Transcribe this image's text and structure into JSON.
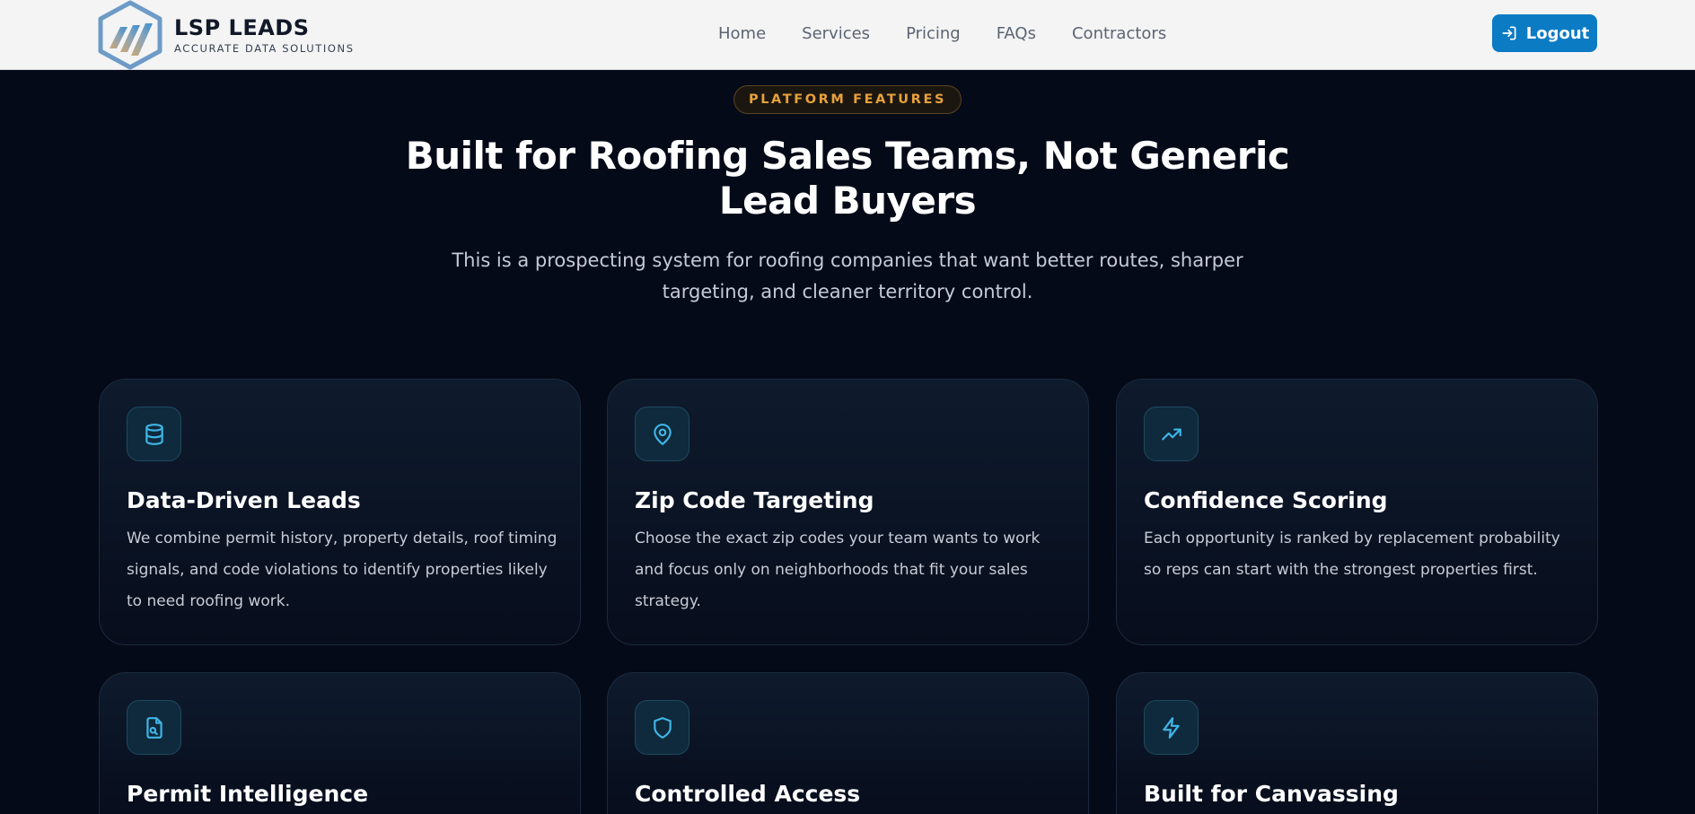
{
  "brand": {
    "name": "LSP LEADS",
    "tagline": "ACCURATE DATA SOLUTIONS"
  },
  "nav": {
    "items": [
      {
        "label": "Home"
      },
      {
        "label": "Services"
      },
      {
        "label": "Pricing"
      },
      {
        "label": "FAQs"
      },
      {
        "label": "Contractors"
      }
    ],
    "logout_label": "Logout"
  },
  "hero": {
    "badge": "PLATFORM FEATURES",
    "title": "Built for Roofing Sales Teams, Not Generic Lead Buyers",
    "subtitle": "This is a prospecting system for roofing companies that want better routes, sharper targeting, and cleaner territory control."
  },
  "features": [
    {
      "icon": "database-icon",
      "title": "Data-Driven Leads",
      "description": "We combine permit history, property details, roof timing signals, and code violations to identify properties likely to need roofing work."
    },
    {
      "icon": "map-pin-icon",
      "title": "Zip Code Targeting",
      "description": "Choose the exact zip codes your team wants to work and focus only on neighborhoods that fit your sales strategy."
    },
    {
      "icon": "trending-up-icon",
      "title": "Confidence Scoring",
      "description": "Each opportunity is ranked by replacement probability so reps can start with the strongest properties first."
    },
    {
      "icon": "file-search-icon",
      "title": "Permit Intelligence",
      "description": ""
    },
    {
      "icon": "shield-icon",
      "title": "Controlled Access",
      "description": ""
    },
    {
      "icon": "lightning-icon",
      "title": "Built for Canvassing",
      "description": ""
    }
  ],
  "colors": {
    "page_background": "#050a18",
    "navbar_background": "#f4f4f5",
    "accent_blue": "#0b7bc4",
    "badge_amber": "#e8a13b",
    "icon_cyan": "#3fb6e6"
  }
}
